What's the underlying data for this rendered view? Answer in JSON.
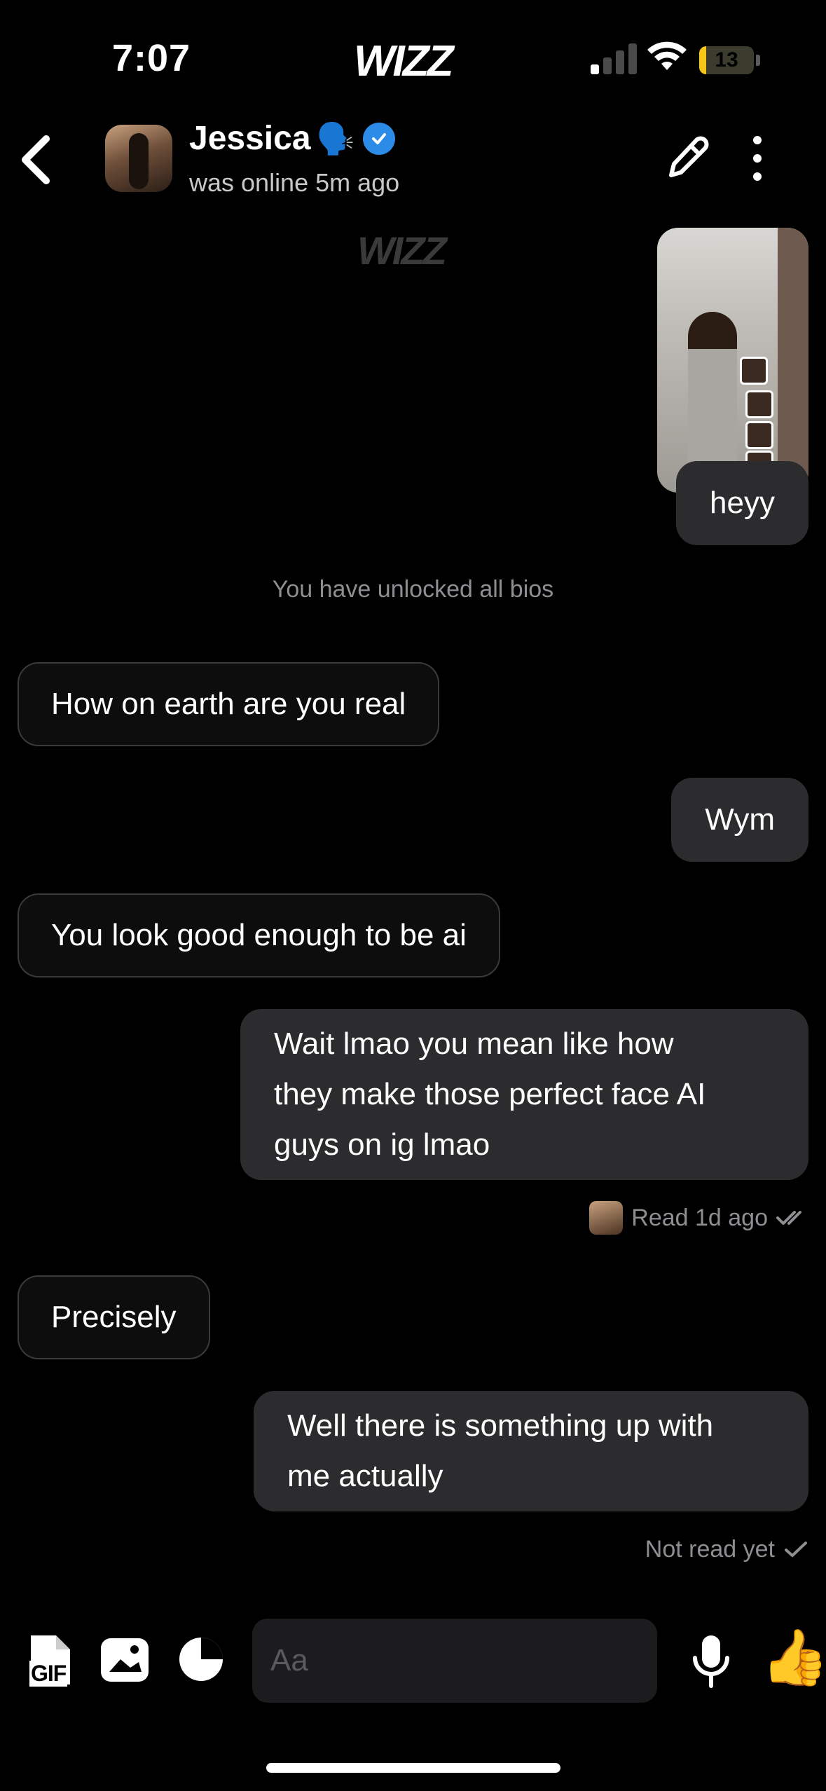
{
  "status_bar": {
    "time": "7:07",
    "app_logo": "WIZZ",
    "battery": "13",
    "battery_level": 0.13,
    "signal_bars": 1
  },
  "header": {
    "name": "Jessica",
    "name_emoji": "🗣️",
    "verified": true,
    "status": "was online 5m ago",
    "icons": [
      "back-chevron-icon",
      "pen-icon",
      "more-vertical-icon"
    ]
  },
  "chat": {
    "watermark": "WIZZ",
    "system_notice": "You have unlocked all bios",
    "messages": [
      {
        "side": "out",
        "text": "heyy"
      },
      {
        "side": "in",
        "text": "How on earth are you real"
      },
      {
        "side": "out",
        "text": "Wym"
      },
      {
        "side": "in",
        "text": "You look good enough to be ai"
      },
      {
        "side": "out",
        "lines": [
          "Wait lmao you mean like how",
          "they make those perfect face AI",
          "guys on ig lmao"
        ]
      },
      {
        "side": "in",
        "text": "Precisely"
      },
      {
        "side": "out",
        "lines": [
          "Well there is something up with",
          "me actually"
        ]
      }
    ],
    "read_receipt": "Read 1d ago",
    "not_read_receipt": "Not read yet"
  },
  "input_bar": {
    "placeholder": "Aa",
    "gif_label": "GIF",
    "thumbs_emoji": "👍",
    "icons": [
      "gif-icon",
      "photo-icon",
      "moon-icon",
      "microphone-icon",
      "thumbs-up-icon"
    ]
  },
  "colors": {
    "background": "#000000",
    "outgoing_bubble": "#2c2c2e",
    "incoming_border": "#3a3a3c",
    "verified": "#2b8be6",
    "battery": "#f5c518"
  }
}
